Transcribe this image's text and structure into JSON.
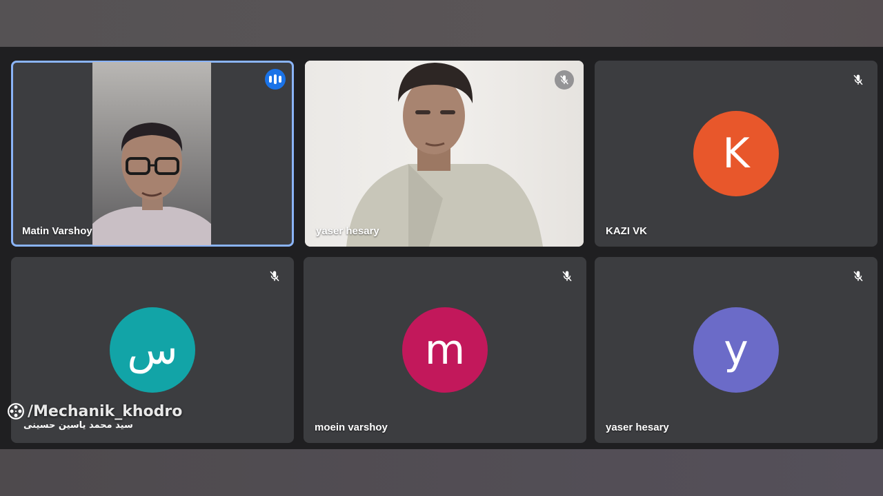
{
  "participants": [
    {
      "name": "Matin Varshoy",
      "status": "speaking"
    },
    {
      "name": "yaser hesary",
      "status": "muted"
    },
    {
      "name": "KAZI VK",
      "initial": "K",
      "color": "#e8572b",
      "status": "muted"
    },
    {
      "name": "سید محمد یاسین حسینی",
      "initial": "س",
      "color": "#12a4a7",
      "status": "muted"
    },
    {
      "name": "moein varshoy",
      "initial": "m",
      "color": "#c2185b",
      "status": "muted"
    },
    {
      "name": "yaser hesary",
      "initial": "y",
      "color": "#6b6bc8",
      "status": "muted"
    }
  ],
  "watermark": {
    "text": "/Mechanik_khodro",
    "icon": "film-reel-icon"
  },
  "icons": {
    "muted": "mic-off-icon",
    "speaking": "audio-level-icon"
  },
  "colors": {
    "active_outline": "#8ab4f8",
    "speaking_badge": "#1a73e8",
    "tile_bg": "#3c3d40"
  }
}
